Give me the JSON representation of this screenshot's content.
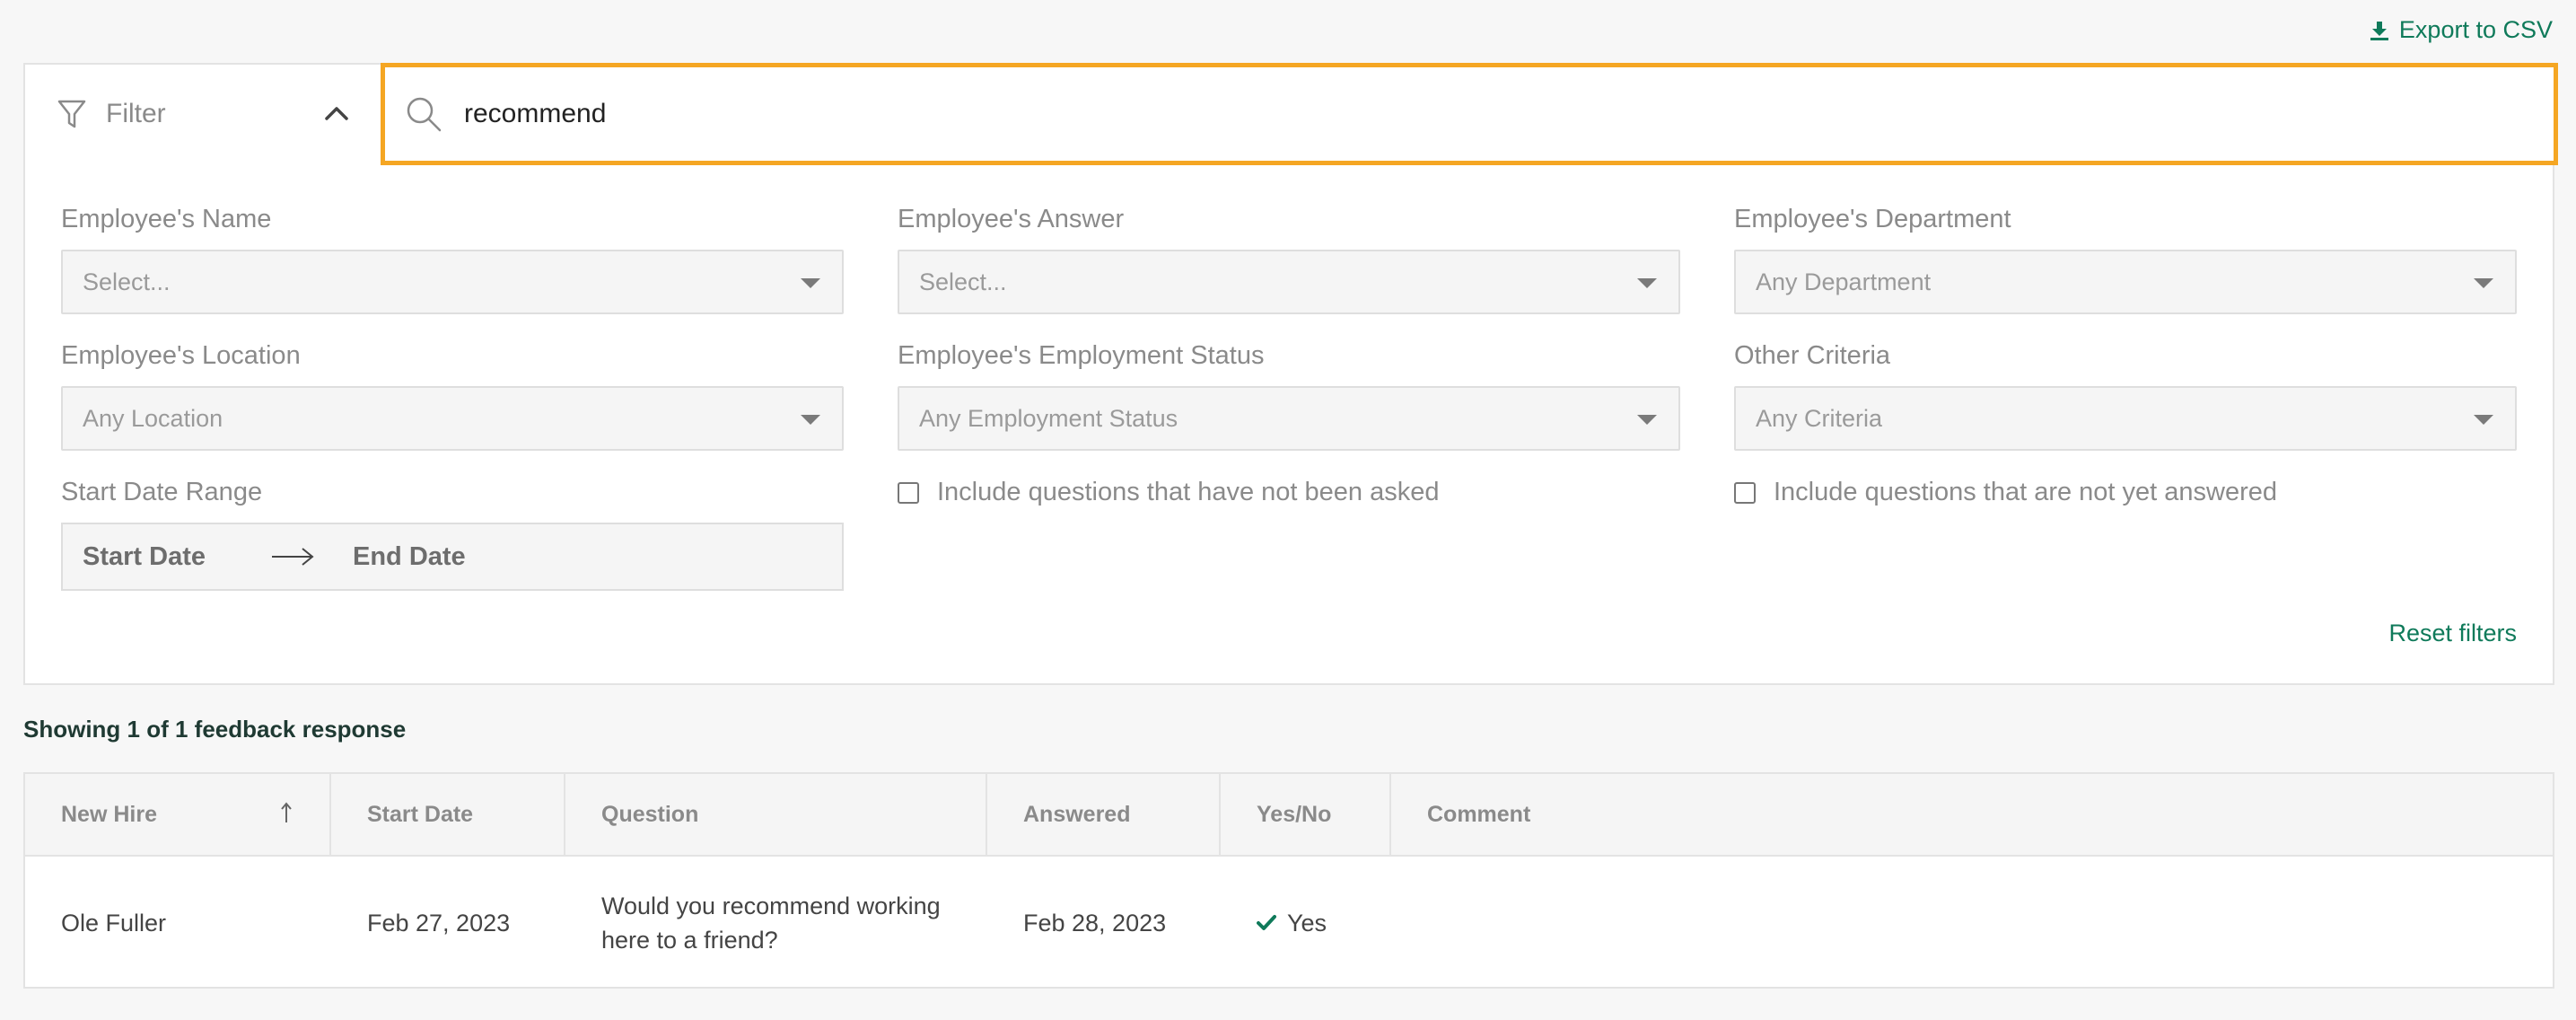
{
  "export": {
    "label": "Export to CSV",
    "icon": "download-icon"
  },
  "filter": {
    "label": "Filter",
    "search_value": "recommend",
    "fields": {
      "name": {
        "label": "Employee's Name",
        "value": "Select..."
      },
      "answer": {
        "label": "Employee's Answer",
        "value": "Select..."
      },
      "department": {
        "label": "Employee's Department",
        "value": "Any Department"
      },
      "location": {
        "label": "Employee's Location",
        "value": "Any Location"
      },
      "employment_status": {
        "label": "Employee's Employment Status",
        "value": "Any Employment Status"
      },
      "other": {
        "label": "Other Criteria",
        "value": "Any Criteria"
      }
    },
    "date_range": {
      "label": "Start Date Range",
      "start": "Start Date",
      "end": "End Date"
    },
    "checkboxes": {
      "not_asked": "Include questions that have not been asked",
      "not_answered": "Include questions that are not yet answered"
    },
    "reset_label": "Reset filters"
  },
  "results": {
    "showing": "Showing 1 of 1 feedback response"
  },
  "table": {
    "headers": {
      "new_hire": "New Hire",
      "start_date": "Start Date",
      "question": "Question",
      "answered": "Answered",
      "yes_no": "Yes/No",
      "comment": "Comment"
    },
    "sort_indicator": "↑",
    "rows": [
      {
        "new_hire": "Ole Fuller",
        "start_date": "Feb 27, 2023",
        "question_line1": "Would you recommend working",
        "question_line2": "here to a friend?",
        "answered": "Feb 28, 2023",
        "yes_no": "Yes",
        "comment": ""
      }
    ]
  },
  "colors": {
    "accent": "#0f7a5a",
    "search_border": "#f5a623"
  }
}
